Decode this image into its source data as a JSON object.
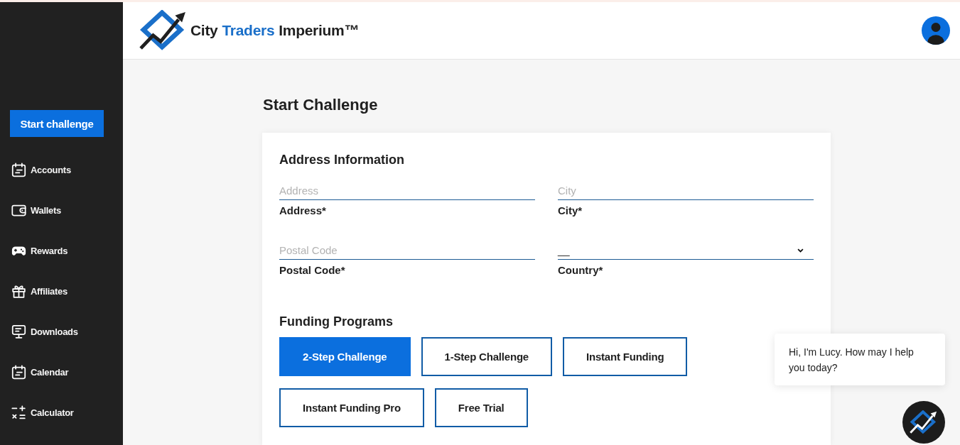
{
  "header": {
    "brand": [
      {
        "text": "City",
        "color": "#1f1f1f"
      },
      {
        "text": "Traders",
        "color": "#1a6fc9"
      },
      {
        "text": "Imperium™",
        "color": "#1f1f1f"
      }
    ]
  },
  "sidebar": {
    "start_button": "Start challenge",
    "items": [
      {
        "label": "Accounts",
        "selected": false
      },
      {
        "label": "Wallets",
        "selected": false
      },
      {
        "label": "Rewards",
        "selected": false
      },
      {
        "label": "Affiliates",
        "selected": false
      },
      {
        "label": "Downloads",
        "selected": false
      },
      {
        "label": "Calendar",
        "selected": false
      },
      {
        "label": "Calculator",
        "selected": false
      }
    ]
  },
  "page": {
    "title": "Start Challenge"
  },
  "address_section": {
    "title": "Address Information",
    "fields": [
      {
        "kind": "text",
        "placeholder": "Address",
        "label": "Address*"
      },
      {
        "kind": "text",
        "placeholder": "City",
        "label": "City*"
      },
      {
        "kind": "text",
        "placeholder": "Postal Code",
        "label": "Postal Code*"
      },
      {
        "kind": "select",
        "value": "__",
        "label": "Country*"
      }
    ]
  },
  "funding_section": {
    "title": "Funding Programs",
    "programs": [
      {
        "label": "2-Step Challenge",
        "selected": true
      },
      {
        "label": "1-Step Challenge",
        "selected": false
      },
      {
        "label": "Instant Funding",
        "selected": false
      },
      {
        "label": "Instant Funding Pro",
        "selected": false
      },
      {
        "label": "Free Trial",
        "selected": false
      }
    ]
  },
  "chat": {
    "message": "Hi, I'm Lucy. How may I help you today?"
  }
}
